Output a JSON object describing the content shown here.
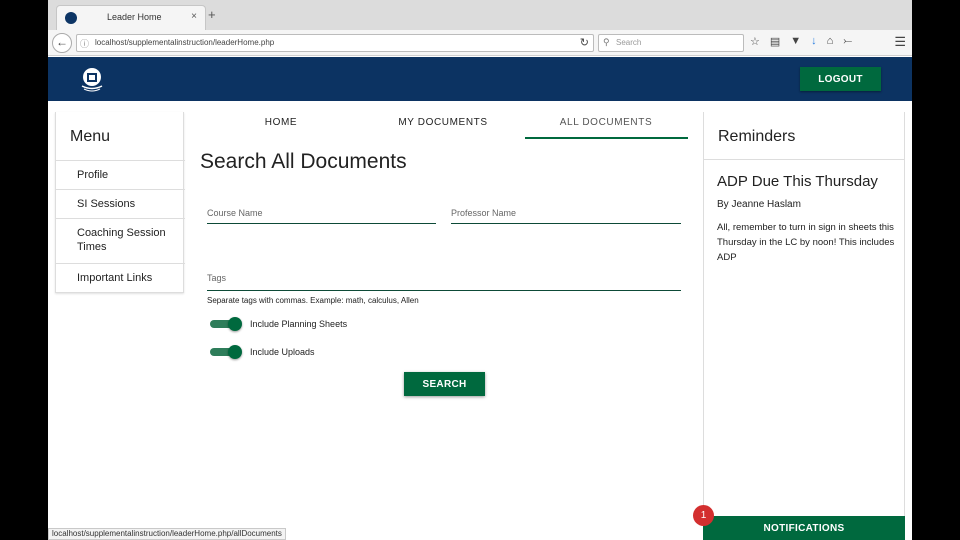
{
  "browser": {
    "tab_title": "Leader Home",
    "tab_close": "×",
    "new_tab": "+",
    "url": "localhost/supplementalinstruction/leaderHome.php",
    "search_placeholder": "Search",
    "status_url": "localhost/supplementalinstruction/leaderHome.php/allDocuments"
  },
  "header": {
    "logout_label": "LOGOUT",
    "brand_color": "#0c3362",
    "accent_color": "#00693e"
  },
  "menu": {
    "title": "Menu",
    "items": [
      {
        "label": "Profile"
      },
      {
        "label": "SI Sessions"
      },
      {
        "label": "Coaching Session Times"
      },
      {
        "label": "Important Links"
      }
    ]
  },
  "tabs": [
    {
      "label": "HOME",
      "active": false
    },
    {
      "label": "MY DOCUMENTS",
      "active": false
    },
    {
      "label": "ALL DOCUMENTS",
      "active": true
    }
  ],
  "search_form": {
    "title": "Search All Documents",
    "course_placeholder": "Course Name",
    "professor_placeholder": "Professor Name",
    "tags_placeholder": "Tags",
    "tags_hint": "Separate tags with commas. Example: math, calculus, Allen",
    "toggles": [
      {
        "label": "Include Planning Sheets",
        "on": true
      },
      {
        "label": "Include Uploads",
        "on": true
      }
    ],
    "search_label": "SEARCH"
  },
  "reminders": {
    "title": "Reminders",
    "items": [
      {
        "heading": "ADP Due This Thursday",
        "author": "By Jeanne Haslam",
        "body": "All, remember to turn in sign in sheets this Thursday in the LC by noon! This includes ADP"
      }
    ],
    "notifications_label": "NOTIFICATIONS",
    "notification_count": "1"
  }
}
